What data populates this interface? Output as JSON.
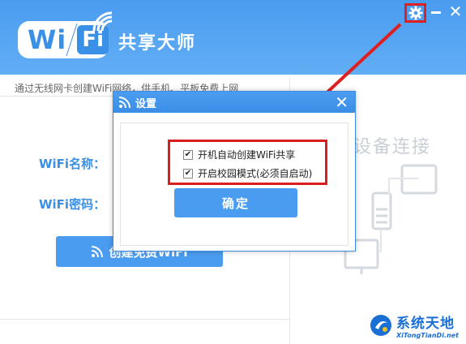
{
  "header": {
    "logo_wi": "Wi",
    "logo_fi": "Fi",
    "app_name": "共享大师"
  },
  "left": {
    "description": "通过无线网卡创建WiFi网络，供手机、平板免费上网",
    "wifi_name_label": "WiFi名称：",
    "wifi_password_label": "WiFi密码：",
    "create_button_label": "创建免费WiFi"
  },
  "right": {
    "device_title": "设备连接"
  },
  "dialog": {
    "title": "设置",
    "options": [
      {
        "label": "开机自动创建WiFi共享",
        "checked": true
      },
      {
        "label": "开启校园模式(必须自启动)",
        "checked": true
      }
    ],
    "ok_label": "确定"
  },
  "watermark": {
    "cn": "系统天地",
    "en": "XiTongTianDi.net"
  },
  "colors": {
    "brand_blue": "#4a9cf0",
    "highlight_red": "#d81e1e"
  },
  "icons": [
    "wifi-icon",
    "gear-icon",
    "minimize-icon",
    "close-icon",
    "checkbox-checked-icon",
    "phone-icon",
    "tablet-icon",
    "monitor-icon"
  ]
}
